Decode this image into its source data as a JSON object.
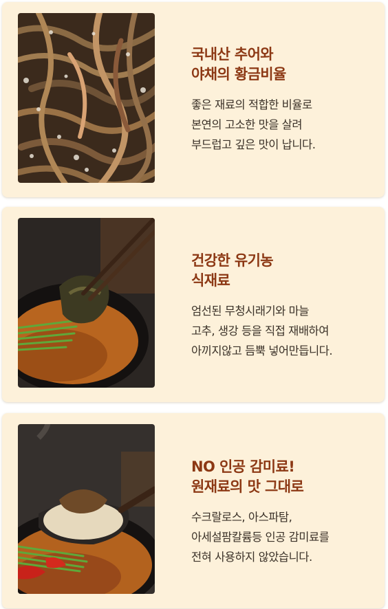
{
  "cards": [
    {
      "headline": [
        "국내산 추어와",
        "야채의 황금비율"
      ],
      "body": [
        "좋은 재료의 적합한 비율로",
        "본연의 고소한 맛을 살려",
        "부드럽고 깊은 맛이 납니다."
      ]
    },
    {
      "headline": [
        "건강한 유기농",
        "식재료"
      ],
      "body": [
        "엄선된 무청시래기와 마늘",
        "고추, 생강 등을 직접 재배하여",
        "아끼지않고 듬뿍 넣어만듭니다."
      ]
    },
    {
      "headline": [
        "NO 인공 감미료!",
        "원재료의 맛 그대로"
      ],
      "body": [
        "수크랄로스, 아스파탐,",
        "아세설팜칼륨등 인공 감미료를",
        "전혀 사용하지 않았습니다."
      ]
    }
  ],
  "colors": {
    "card_background": "#fdf1da",
    "headline": "#8c3814",
    "body_text": "#3a3128"
  }
}
